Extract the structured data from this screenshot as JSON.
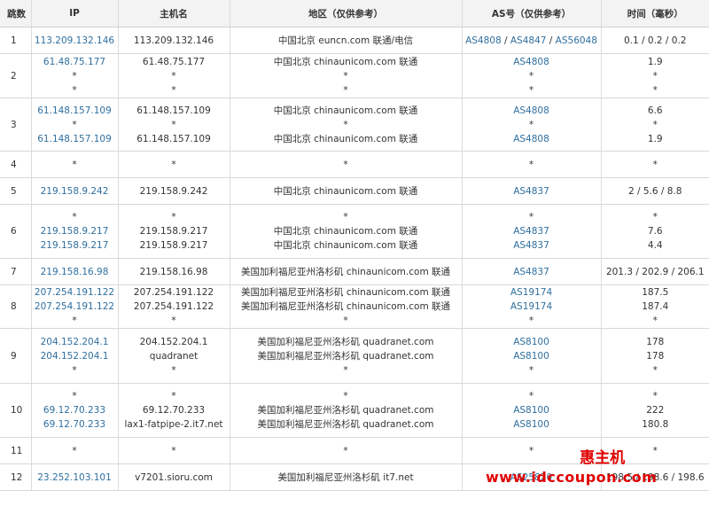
{
  "headers": {
    "hop": "跳数",
    "ip": "IP",
    "host": "主机名",
    "region": "地区（仅供参考）",
    "asn": "AS号（仅供参考）",
    "time": "时间（毫秒）"
  },
  "rows": [
    {
      "hop": "1",
      "ip": [
        "113.209.132.146"
      ],
      "host": [
        "113.209.132.146"
      ],
      "region": [
        "中国北京 euncn.com 联通/电信"
      ],
      "asn": [
        [
          "AS4808",
          "AS4847",
          "AS56048"
        ]
      ],
      "time": [
        "0.1 / 0.2 / 0.2"
      ]
    },
    {
      "hop": "2",
      "ip": [
        "61.48.75.177",
        "*",
        "*"
      ],
      "host": [
        "61.48.75.177",
        "*",
        "*"
      ],
      "region": [
        "中国北京 chinaunicom.com 联通",
        "*",
        "*"
      ],
      "asn": [
        [
          "AS4808"
        ],
        [
          "*"
        ],
        [
          "*"
        ]
      ],
      "time": [
        "1.9",
        "*",
        "*"
      ]
    },
    {
      "hop": "3",
      "ip": [
        "61.148.157.109",
        "*",
        "61.148.157.109"
      ],
      "host": [
        "61.148.157.109",
        "*",
        "61.148.157.109"
      ],
      "region": [
        "中国北京 chinaunicom.com 联通",
        "*",
        "中国北京 chinaunicom.com 联通"
      ],
      "asn": [
        [
          "AS4808"
        ],
        [
          "*"
        ],
        [
          "AS4808"
        ]
      ],
      "time": [
        "6.6",
        "*",
        "1.9"
      ]
    },
    {
      "hop": "4",
      "ip": [
        "*"
      ],
      "host": [
        "*"
      ],
      "region": [
        "*"
      ],
      "asn": [
        [
          "*"
        ]
      ],
      "time": [
        "*"
      ]
    },
    {
      "hop": "5",
      "ip": [
        "219.158.9.242"
      ],
      "host": [
        "219.158.9.242"
      ],
      "region": [
        "中国北京 chinaunicom.com 联通"
      ],
      "asn": [
        [
          "AS4837"
        ]
      ],
      "time": [
        "2 / 5.6 / 8.8"
      ]
    },
    {
      "hop": "6",
      "ip": [
        "*",
        "219.158.9.217",
        "219.158.9.217"
      ],
      "host": [
        "*",
        "219.158.9.217",
        "219.158.9.217"
      ],
      "region": [
        "*",
        "中国北京 chinaunicom.com 联通",
        "中国北京 chinaunicom.com 联通"
      ],
      "asn": [
        [
          "*"
        ],
        [
          "AS4837"
        ],
        [
          "AS4837"
        ]
      ],
      "time": [
        "*",
        "7.6",
        "4.4"
      ]
    },
    {
      "hop": "7",
      "ip": [
        "219.158.16.98"
      ],
      "host": [
        "219.158.16.98"
      ],
      "region": [
        "美国加利福尼亚州洛杉矶 chinaunicom.com 联通"
      ],
      "asn": [
        [
          "AS4837"
        ]
      ],
      "time": [
        "201.3 / 202.9 / 206.1"
      ]
    },
    {
      "hop": "8",
      "ip": [
        "207.254.191.122",
        "207.254.191.122",
        "*"
      ],
      "host": [
        "207.254.191.122",
        "207.254.191.122",
        "*"
      ],
      "region": [
        "美国加利福尼亚州洛杉矶 chinaunicom.com 联通",
        "美国加利福尼亚州洛杉矶 chinaunicom.com 联通",
        "*"
      ],
      "asn": [
        [
          "AS19174"
        ],
        [
          "AS19174"
        ],
        [
          "*"
        ]
      ],
      "time": [
        "187.5",
        "187.4",
        "*"
      ]
    },
    {
      "hop": "9",
      "ip": [
        "204.152.204.1",
        "204.152.204.1",
        "*"
      ],
      "host": [
        "204.152.204.1",
        "quadranet",
        "*"
      ],
      "region": [
        "美国加利福尼亚州洛杉矶 quadranet.com",
        "美国加利福尼亚州洛杉矶 quadranet.com",
        "*"
      ],
      "asn": [
        [
          "AS8100"
        ],
        [
          "AS8100"
        ],
        [
          "*"
        ]
      ],
      "time": [
        "178",
        "178",
        "*"
      ]
    },
    {
      "hop": "10",
      "ip": [
        "*",
        "69.12.70.233",
        "69.12.70.233"
      ],
      "host": [
        "*",
        "69.12.70.233",
        "lax1-fatpipe-2.it7.net"
      ],
      "region": [
        "*",
        "美国加利福尼亚州洛杉矶 quadranet.com",
        "美国加利福尼亚州洛杉矶 quadranet.com"
      ],
      "asn": [
        [
          "*"
        ],
        [
          "AS8100"
        ],
        [
          "AS8100"
        ]
      ],
      "time": [
        "*",
        "222",
        "180.8"
      ]
    },
    {
      "hop": "11",
      "ip": [
        "*"
      ],
      "host": [
        "*"
      ],
      "region": [
        "*"
      ],
      "asn": [
        [
          "*"
        ]
      ],
      "time": [
        "*"
      ]
    },
    {
      "hop": "12",
      "ip": [
        "23.252.103.101"
      ],
      "host": [
        "v7201.sioru.com"
      ],
      "region": [
        "美国加利福尼亚州洛杉矶 it7.net"
      ],
      "asn": [
        [
          "AS25820"
        ]
      ],
      "time": [
        "198.5 / 198.6 / 198.6"
      ]
    }
  ],
  "watermark": {
    "cn": "惠主机",
    "url": "www.idccoupon.com"
  },
  "colors": {
    "link": "#2f6f9f",
    "header_bg": "#f3f3f3",
    "watermark": "#e00000"
  }
}
